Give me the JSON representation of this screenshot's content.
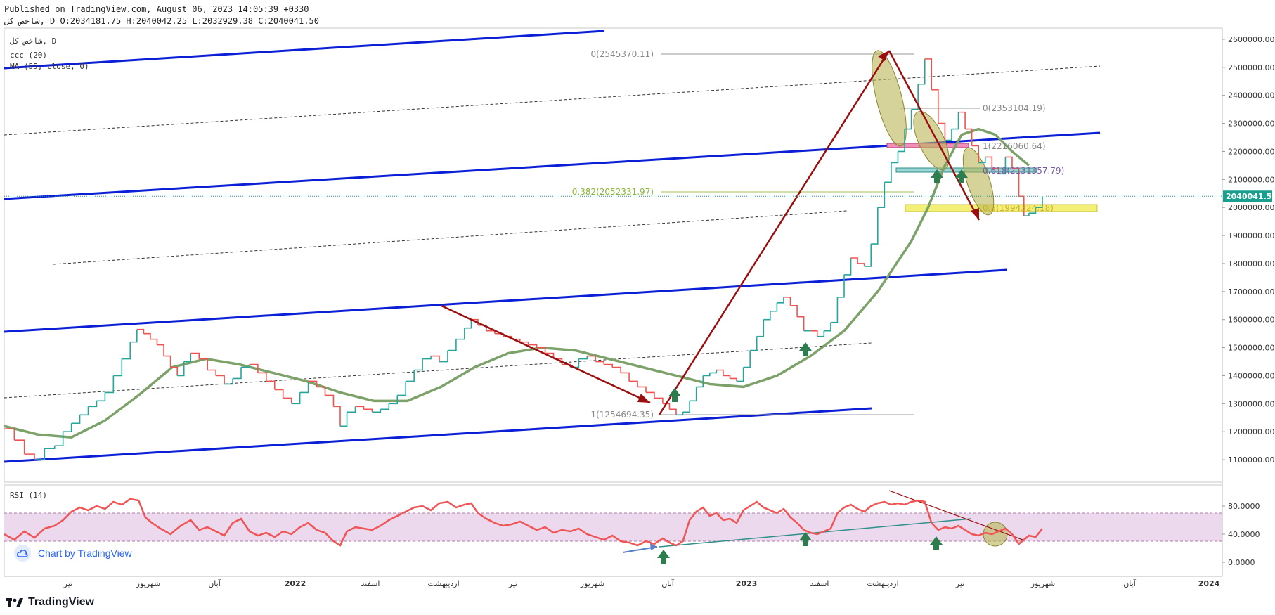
{
  "header": {
    "published": "Published on TradingView.com, August 06, 2023 14:05:39 +0330",
    "ohlc": "شاخص کل, D O:2034181.75 H:2040042.25 L:2032929.38 C:2040041.50"
  },
  "legend": {
    "symbol": "شاخص کل, D",
    "line2": "ccc (20)",
    "line3": "MA (55, close, 0)"
  },
  "badge": {
    "label": "Chart by TradingView"
  },
  "brand": {
    "label": "TradingView"
  },
  "colors": {
    "up": "#26a69a",
    "down": "#ef5350",
    "ma": "#7ca26a",
    "channel": "#0a1fd6",
    "arrow": "#9b0e0e",
    "rsi": "#f05454",
    "rsi_band": "#ecd9ee",
    "price_line": "#1a9e8e"
  },
  "chart_data": {
    "type": "line",
    "main": {
      "yaxis_ticks": [
        1100000,
        1200000,
        1300000,
        1400000,
        1500000,
        1600000,
        1700000,
        1800000,
        1900000,
        2000000,
        2100000,
        2200000,
        2300000,
        2400000,
        2500000,
        2600000
      ],
      "yaxis_tick_labels": [
        "1100000.00",
        "1200000.00",
        "1300000.00",
        "1400000.00",
        "1500000.00",
        "1600000.00",
        "1700000.00",
        "1800000.00",
        "1900000.00",
        "2000000.00",
        "2100000.00",
        "2200000.00",
        "2300000.00",
        "2400000.00",
        "2500000.00",
        "2600000.00"
      ],
      "ylim": [
        1020000,
        2640000
      ],
      "last_price": 2040041.5,
      "last_price_label": "2040041.50",
      "xlim": [
        0,
        1000
      ],
      "close_series": [
        [
          0,
          1210000
        ],
        [
          12,
          1170000
        ],
        [
          24,
          1120000
        ],
        [
          36,
          1100000
        ],
        [
          48,
          1140000
        ],
        [
          60,
          1150000
        ],
        [
          70,
          1200000
        ],
        [
          80,
          1230000
        ],
        [
          90,
          1260000
        ],
        [
          100,
          1290000
        ],
        [
          110,
          1310000
        ],
        [
          120,
          1340000
        ],
        [
          130,
          1400000
        ],
        [
          140,
          1460000
        ],
        [
          150,
          1520000
        ],
        [
          158,
          1565000
        ],
        [
          166,
          1550000
        ],
        [
          174,
          1530000
        ],
        [
          182,
          1510000
        ],
        [
          190,
          1470000
        ],
        [
          198,
          1430000
        ],
        [
          206,
          1400000
        ],
        [
          214,
          1450000
        ],
        [
          222,
          1480000
        ],
        [
          232,
          1460000
        ],
        [
          242,
          1420000
        ],
        [
          252,
          1400000
        ],
        [
          262,
          1370000
        ],
        [
          272,
          1390000
        ],
        [
          282,
          1430000
        ],
        [
          292,
          1440000
        ],
        [
          302,
          1410000
        ],
        [
          312,
          1380000
        ],
        [
          322,
          1350000
        ],
        [
          332,
          1320000
        ],
        [
          342,
          1300000
        ],
        [
          352,
          1340000
        ],
        [
          362,
          1380000
        ],
        [
          372,
          1360000
        ],
        [
          382,
          1330000
        ],
        [
          392,
          1290000
        ],
        [
          400,
          1220000
        ],
        [
          408,
          1270000
        ],
        [
          418,
          1290000
        ],
        [
          428,
          1280000
        ],
        [
          438,
          1270000
        ],
        [
          448,
          1280000
        ],
        [
          458,
          1300000
        ],
        [
          468,
          1330000
        ],
        [
          478,
          1380000
        ],
        [
          488,
          1420000
        ],
        [
          498,
          1460000
        ],
        [
          508,
          1470000
        ],
        [
          518,
          1450000
        ],
        [
          528,
          1490000
        ],
        [
          538,
          1530000
        ],
        [
          548,
          1570000
        ],
        [
          556,
          1600000
        ],
        [
          564,
          1580000
        ],
        [
          574,
          1560000
        ],
        [
          584,
          1550000
        ],
        [
          594,
          1540000
        ],
        [
          604,
          1530000
        ],
        [
          614,
          1520000
        ],
        [
          624,
          1510000
        ],
        [
          634,
          1500000
        ],
        [
          644,
          1480000
        ],
        [
          654,
          1460000
        ],
        [
          664,
          1440000
        ],
        [
          674,
          1430000
        ],
        [
          684,
          1460000
        ],
        [
          694,
          1470000
        ],
        [
          704,
          1450000
        ],
        [
          714,
          1440000
        ],
        [
          724,
          1430000
        ],
        [
          734,
          1410000
        ],
        [
          744,
          1380000
        ],
        [
          754,
          1360000
        ],
        [
          764,
          1340000
        ],
        [
          774,
          1320000
        ],
        [
          784,
          1300000
        ],
        [
          792,
          1280000
        ],
        [
          800,
          1260000
        ],
        [
          808,
          1270000
        ],
        [
          816,
          1310000
        ],
        [
          824,
          1360000
        ],
        [
          832,
          1400000
        ],
        [
          840,
          1410000
        ],
        [
          848,
          1420000
        ],
        [
          856,
          1400000
        ],
        [
          864,
          1390000
        ],
        [
          872,
          1380000
        ],
        [
          880,
          1430000
        ],
        [
          888,
          1490000
        ],
        [
          896,
          1540000
        ],
        [
          904,
          1600000
        ],
        [
          912,
          1630000
        ],
        [
          920,
          1660000
        ],
        [
          928,
          1680000
        ],
        [
          936,
          1650000
        ],
        [
          944,
          1610000
        ],
        [
          952,
          1560000
        ],
        [
          960,
          1560000
        ],
        [
          968,
          1540000
        ],
        [
          976,
          1560000
        ],
        [
          984,
          1590000
        ],
        [
          992,
          1680000
        ],
        [
          1000,
          1760000
        ],
        [
          1008,
          1820000
        ],
        [
          1016,
          1800000
        ],
        [
          1024,
          1790000
        ],
        [
          1032,
          1870000
        ],
        [
          1040,
          2000000
        ],
        [
          1048,
          2090000
        ],
        [
          1056,
          2160000
        ],
        [
          1064,
          2200000
        ],
        [
          1072,
          2280000
        ],
        [
          1080,
          2350000
        ],
        [
          1088,
          2440000
        ],
        [
          1096,
          2530000
        ],
        [
          1104,
          2420000
        ],
        [
          1112,
          2300000
        ],
        [
          1120,
          2240000
        ],
        [
          1128,
          2280000
        ],
        [
          1136,
          2340000
        ],
        [
          1144,
          2280000
        ],
        [
          1152,
          2220000
        ],
        [
          1160,
          2160000
        ],
        [
          1168,
          2180000
        ],
        [
          1176,
          2140000
        ],
        [
          1184,
          2120000
        ],
        [
          1192,
          2180000
        ],
        [
          1200,
          2140000
        ],
        [
          1208,
          2040000
        ],
        [
          1214,
          1970000
        ],
        [
          1220,
          1980000
        ],
        [
          1228,
          2000000
        ],
        [
          1236,
          2040000
        ]
      ],
      "ma_series": [
        [
          0,
          1220000
        ],
        [
          40,
          1190000
        ],
        [
          80,
          1180000
        ],
        [
          120,
          1240000
        ],
        [
          160,
          1330000
        ],
        [
          200,
          1430000
        ],
        [
          240,
          1460000
        ],
        [
          280,
          1440000
        ],
        [
          320,
          1410000
        ],
        [
          360,
          1380000
        ],
        [
          400,
          1340000
        ],
        [
          440,
          1310000
        ],
        [
          480,
          1310000
        ],
        [
          520,
          1360000
        ],
        [
          560,
          1430000
        ],
        [
          600,
          1480000
        ],
        [
          640,
          1500000
        ],
        [
          680,
          1490000
        ],
        [
          720,
          1460000
        ],
        [
          760,
          1430000
        ],
        [
          800,
          1400000
        ],
        [
          840,
          1370000
        ],
        [
          880,
          1360000
        ],
        [
          920,
          1400000
        ],
        [
          960,
          1470000
        ],
        [
          1000,
          1560000
        ],
        [
          1040,
          1700000
        ],
        [
          1080,
          1880000
        ],
        [
          1100,
          2000000
        ],
        [
          1120,
          2150000
        ],
        [
          1140,
          2260000
        ],
        [
          1160,
          2280000
        ],
        [
          1180,
          2260000
        ],
        [
          1200,
          2200000
        ],
        [
          1220,
          2150000
        ]
      ],
      "fib_labels": [
        {
          "text": "0(2545370.11)",
          "price": 2545370.11
        },
        {
          "text": "0(2353104.19)",
          "price": 2353104.19
        },
        {
          "text": "1(2216060.64)",
          "price": 2216060.64
        },
        {
          "text": "0.618(2131357.79)",
          "price": 2131357.79
        },
        {
          "text": "0.382(2052331.97)",
          "price": 2052331.97
        },
        {
          "text": "0.5(1994324.18)",
          "price": 1994324.18
        },
        {
          "text": "1(1254694.35)",
          "price": 1254694.35
        }
      ]
    },
    "rsi": {
      "title": "RSI (14)",
      "ylim": [
        -20,
        110
      ],
      "ticks": [
        0,
        40,
        80
      ],
      "tick_labels": [
        "0.0000",
        "40.0000",
        "80.0000"
      ],
      "band": [
        30,
        70
      ],
      "series": [
        [
          0,
          40
        ],
        [
          12,
          32
        ],
        [
          24,
          44
        ],
        [
          36,
          35
        ],
        [
          48,
          48
        ],
        [
          60,
          52
        ],
        [
          70,
          60
        ],
        [
          80,
          72
        ],
        [
          90,
          78
        ],
        [
          100,
          74
        ],
        [
          110,
          80
        ],
        [
          120,
          76
        ],
        [
          130,
          86
        ],
        [
          140,
          82
        ],
        [
          150,
          90
        ],
        [
          160,
          88
        ],
        [
          168,
          64
        ],
        [
          176,
          56
        ],
        [
          186,
          48
        ],
        [
          198,
          40
        ],
        [
          210,
          52
        ],
        [
          222,
          60
        ],
        [
          232,
          46
        ],
        [
          242,
          50
        ],
        [
          252,
          44
        ],
        [
          262,
          38
        ],
        [
          272,
          56
        ],
        [
          282,
          62
        ],
        [
          292,
          44
        ],
        [
          302,
          38
        ],
        [
          312,
          42
        ],
        [
          322,
          36
        ],
        [
          332,
          44
        ],
        [
          342,
          40
        ],
        [
          352,
          50
        ],
        [
          362,
          56
        ],
        [
          372,
          46
        ],
        [
          382,
          42
        ],
        [
          392,
          30
        ],
        [
          400,
          24
        ],
        [
          408,
          44
        ],
        [
          418,
          50
        ],
        [
          428,
          48
        ],
        [
          438,
          46
        ],
        [
          448,
          52
        ],
        [
          458,
          60
        ],
        [
          468,
          66
        ],
        [
          478,
          72
        ],
        [
          488,
          78
        ],
        [
          498,
          80
        ],
        [
          508,
          74
        ],
        [
          518,
          84
        ],
        [
          528,
          86
        ],
        [
          538,
          78
        ],
        [
          548,
          82
        ],
        [
          556,
          84
        ],
        [
          564,
          70
        ],
        [
          574,
          62
        ],
        [
          584,
          56
        ],
        [
          594,
          52
        ],
        [
          604,
          54
        ],
        [
          614,
          58
        ],
        [
          624,
          52
        ],
        [
          634,
          46
        ],
        [
          644,
          50
        ],
        [
          654,
          42
        ],
        [
          664,
          46
        ],
        [
          674,
          44
        ],
        [
          684,
          48
        ],
        [
          694,
          40
        ],
        [
          704,
          36
        ],
        [
          714,
          32
        ],
        [
          724,
          38
        ],
        [
          734,
          30
        ],
        [
          744,
          28
        ],
        [
          754,
          24
        ],
        [
          764,
          30
        ],
        [
          774,
          26
        ],
        [
          784,
          34
        ],
        [
          792,
          28
        ],
        [
          800,
          24
        ],
        [
          808,
          30
        ],
        [
          816,
          60
        ],
        [
          824,
          72
        ],
        [
          832,
          78
        ],
        [
          840,
          66
        ],
        [
          848,
          70
        ],
        [
          856,
          60
        ],
        [
          864,
          62
        ],
        [
          872,
          56
        ],
        [
          880,
          74
        ],
        [
          888,
          80
        ],
        [
          896,
          86
        ],
        [
          904,
          78
        ],
        [
          912,
          74
        ],
        [
          920,
          70
        ],
        [
          928,
          76
        ],
        [
          936,
          64
        ],
        [
          944,
          56
        ],
        [
          952,
          46
        ],
        [
          960,
          42
        ],
        [
          968,
          40
        ],
        [
          976,
          44
        ],
        [
          984,
          48
        ],
        [
          992,
          70
        ],
        [
          1000,
          78
        ],
        [
          1008,
          82
        ],
        [
          1016,
          76
        ],
        [
          1024,
          72
        ],
        [
          1032,
          80
        ],
        [
          1040,
          84
        ],
        [
          1048,
          86
        ],
        [
          1056,
          82
        ],
        [
          1064,
          84
        ],
        [
          1072,
          82
        ],
        [
          1080,
          86
        ],
        [
          1088,
          88
        ],
        [
          1096,
          86
        ],
        [
          1104,
          56
        ],
        [
          1112,
          46
        ],
        [
          1120,
          50
        ],
        [
          1128,
          48
        ],
        [
          1136,
          52
        ],
        [
          1144,
          46
        ],
        [
          1152,
          40
        ],
        [
          1160,
          38
        ],
        [
          1168,
          42
        ],
        [
          1176,
          40
        ],
        [
          1184,
          44
        ],
        [
          1192,
          48
        ],
        [
          1200,
          40
        ],
        [
          1208,
          26
        ],
        [
          1214,
          32
        ],
        [
          1220,
          38
        ],
        [
          1228,
          36
        ],
        [
          1236,
          48
        ]
      ]
    },
    "xaxis_labels": [
      "تیر",
      "شهریور",
      "آبان",
      "2022",
      "اسفند",
      "اردیبهشت",
      "تیر",
      "شهریور",
      "آبان",
      "2023",
      "اسفند",
      "اردیبهشت",
      "تیر",
      "شهریور",
      "آبان",
      "2024"
    ]
  }
}
